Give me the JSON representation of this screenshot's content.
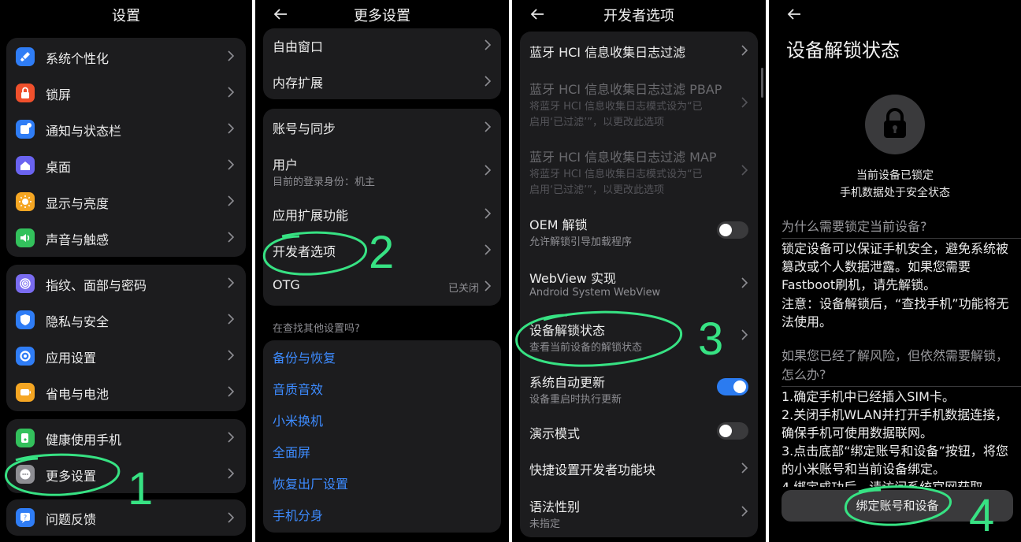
{
  "panel1": {
    "title": "设置",
    "group1": [
      {
        "label": "系统个性化",
        "icon": "paintbrush-icon",
        "color": "#2f7df6"
      },
      {
        "label": "锁屏",
        "icon": "lock-icon",
        "color": "#f0502c"
      },
      {
        "label": "通知与状态栏",
        "icon": "notification-icon",
        "color": "#2f7df6"
      },
      {
        "label": "桌面",
        "icon": "home-icon",
        "color": "#6a63f0"
      },
      {
        "label": "显示与亮度",
        "icon": "sun-icon",
        "color": "#f5a623"
      },
      {
        "label": "声音与触感",
        "icon": "speaker-icon",
        "color": "#33c15c"
      }
    ],
    "group2": [
      {
        "label": "指纹、面部与密码",
        "icon": "fingerprint-icon",
        "color": "#7a6cf0"
      },
      {
        "label": "隐私与安全",
        "icon": "shield-icon",
        "color": "#2f7df6"
      },
      {
        "label": "应用设置",
        "icon": "gear-icon",
        "color": "#2f7df6"
      },
      {
        "label": "省电与电池",
        "icon": "battery-icon",
        "color": "#f5a623"
      }
    ],
    "group3": [
      {
        "label": "健康使用手机",
        "icon": "health-icon",
        "color": "#33c15c"
      },
      {
        "label": "更多设置",
        "icon": "more-icon",
        "color": "#8e8e93"
      }
    ],
    "group4": [
      {
        "label": "问题反馈",
        "icon": "feedback-icon",
        "color": "#2f7df6"
      }
    ],
    "annotation": "1"
  },
  "panel2": {
    "title": "更多设置",
    "card1": [
      "自由窗口",
      "内存扩展"
    ],
    "card2": [
      {
        "label": "账号与同步"
      },
      {
        "label": "用户",
        "sub": "目前的登录身份：机主"
      },
      {
        "label": "应用扩展功能"
      },
      {
        "label": "开发者选项"
      },
      {
        "label": "OTG",
        "value": "已关闭"
      }
    ],
    "hint": "在查找其他设置吗?",
    "links": [
      "备份与恢复",
      "音质音效",
      "小米换机",
      "全面屏",
      "恢复出厂设置",
      "手机分身"
    ],
    "annotation": "2"
  },
  "panel3": {
    "title": "开发者选项",
    "rows": [
      {
        "label": "蓝牙 HCI 信息收集日志过滤"
      },
      {
        "label": "蓝牙 HCI 信息收集日志过滤 PBAP",
        "sub1": "将蓝牙 HCI 信息收集日志模式设为“已",
        "sub2": "启用‘已过滤’”，以更改此选项"
      },
      {
        "label": "蓝牙 HCI 信息收集日志过滤 MAP",
        "sub1": "将蓝牙 HCI 信息收集日志模式设为“已",
        "sub2": "启用‘已过滤’”，以更改此选项"
      },
      {
        "label": "OEM 解锁",
        "sub": "允许解锁引导加载程序"
      },
      {
        "label": "WebView 实现",
        "sub": "Android System WebView"
      },
      {
        "label": "设备解锁状态",
        "sub": "查看当前设备的解锁状态"
      },
      {
        "label": "系统自动更新",
        "sub": "设备重启时执行更新"
      },
      {
        "label": "演示模式"
      },
      {
        "label": "快捷设置开发者功能块"
      },
      {
        "label": "语法性别",
        "sub": "未指定"
      }
    ],
    "toggles": {
      "oem_unlock": false,
      "auto_update": true,
      "demo_mode": false
    },
    "annotation": "3"
  },
  "panel4": {
    "title": "设备解锁状态",
    "status1": "当前设备已锁定",
    "status2": "手机数据处于安全状态",
    "q1": "为什么需要锁定当前设备?",
    "a1": "锁定设备可以保证手机安全，避免系统被篡改或个人数据泄露。如果您需要Fastboot刷机，请先解锁。",
    "a1b": "注意：设备解锁后，“查找手机”功能将无法使用。",
    "q2": "如果您已经了解风险，但依然需要解锁，怎么办?",
    "steps": [
      "1.确定手机中已经插入SIM卡。",
      "2.关闭手机WLAN并打开手机数据连接，确保手机可使用数据联网。",
      "3.点击底部“绑定账号和设备”按钮，将您的小米账号和当前设备绑定。",
      "4.绑定成功后，请访问系统官网获取"
    ],
    "button": "绑定账号和设备",
    "annotation": "4"
  },
  "colors": {
    "accent": "#3d8bff",
    "annotation": "#37e283",
    "toggle_on": "#2b7bf0"
  }
}
